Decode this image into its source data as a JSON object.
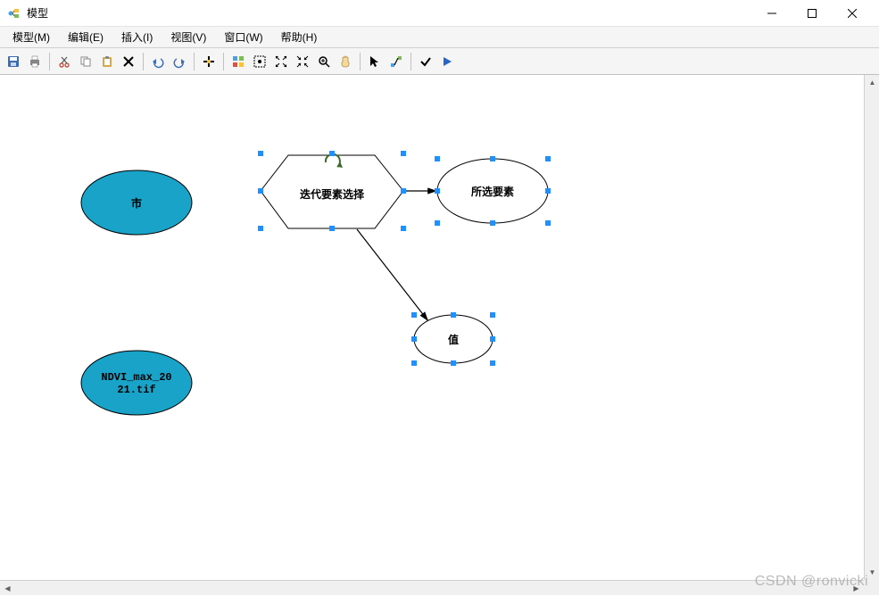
{
  "window": {
    "title": "模型"
  },
  "menu": {
    "model": "模型(M)",
    "edit": "编辑(E)",
    "insert": "插入(I)",
    "view": "视图(V)",
    "window": "窗口(W)",
    "help": "帮助(H)"
  },
  "toolbar_icons": {
    "save": "save-icon",
    "print": "print-icon",
    "cut": "cut-icon",
    "copy": "copy-icon",
    "paste": "paste-icon",
    "delete": "delete-icon",
    "undo": "undo-icon",
    "redo": "redo-icon",
    "add": "add-icon",
    "auto_layout": "auto-layout-icon",
    "full_extent": "full-extent-icon",
    "zoom_in_fixed": "zoom-in-fixed-icon",
    "zoom_out_fixed": "zoom-out-fixed-icon",
    "zoom": "zoom-icon",
    "pan": "pan-icon",
    "select": "select-icon",
    "connect": "connect-icon",
    "validate": "validate-icon",
    "run": "run-icon"
  },
  "nodes": {
    "city": {
      "label": "市",
      "fill": "#1aa3c9",
      "stroke": "#000000"
    },
    "ndvi": {
      "label": "NDVI_max_2021.tif",
      "label_line1": "NDVI_max_20",
      "label_line2": "21.tif",
      "fill": "#1aa3c9",
      "stroke": "#000000"
    },
    "iterator": {
      "label": "迭代要素选择",
      "fill": "#ffffff",
      "stroke": "#000000"
    },
    "selected": {
      "label": "所选要素",
      "fill": "#ffffff",
      "stroke": "#000000"
    },
    "value": {
      "label": "值",
      "fill": "#ffffff",
      "stroke": "#000000"
    }
  },
  "watermark": "CSDN @ronvicki"
}
